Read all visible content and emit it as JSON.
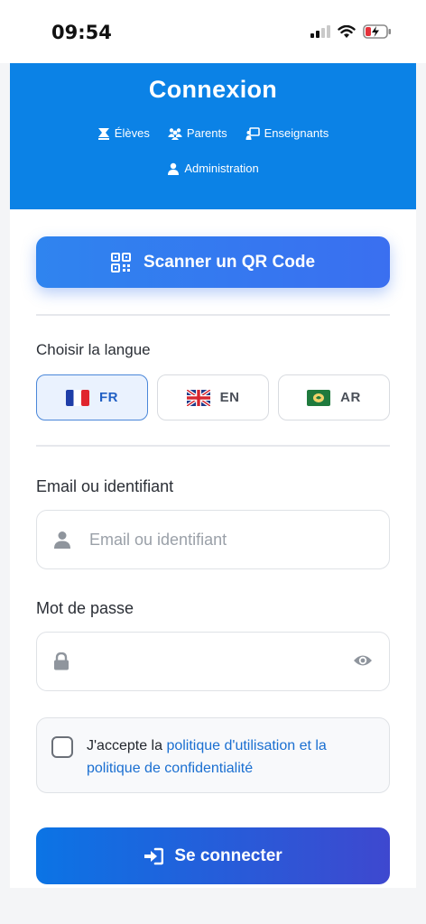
{
  "status_bar": {
    "time": "09:54"
  },
  "header": {
    "title": "Connexion",
    "roles": [
      "Élèves",
      "Parents",
      "Enseignants",
      "Administration"
    ]
  },
  "qr_button": {
    "label": "Scanner un QR Code"
  },
  "language": {
    "label": "Choisir la langue",
    "options": [
      "FR",
      "EN",
      "AR"
    ],
    "selected": "FR"
  },
  "email": {
    "label": "Email ou identifiant",
    "placeholder": "Email ou identifiant",
    "value": ""
  },
  "password": {
    "label": "Mot de passe",
    "value": ""
  },
  "consent": {
    "prefix": "J'accepte la ",
    "link1": "politique d'utilisation et la",
    "link2": "politique de confidentialité"
  },
  "login_button": {
    "label": "Se connecter"
  },
  "colors": {
    "header": "#0b82e6",
    "accent": "#1a6fd1",
    "primary_button_start": "#0b74e5",
    "primary_button_end": "#3e48cf"
  },
  "icons": [
    "signal-icon",
    "wifi-icon",
    "battery-charging-icon",
    "student-icon",
    "parents-icon",
    "teacher-icon",
    "admin-icon",
    "qr-code-icon",
    "user-icon",
    "lock-icon",
    "eye-icon",
    "login-icon"
  ]
}
